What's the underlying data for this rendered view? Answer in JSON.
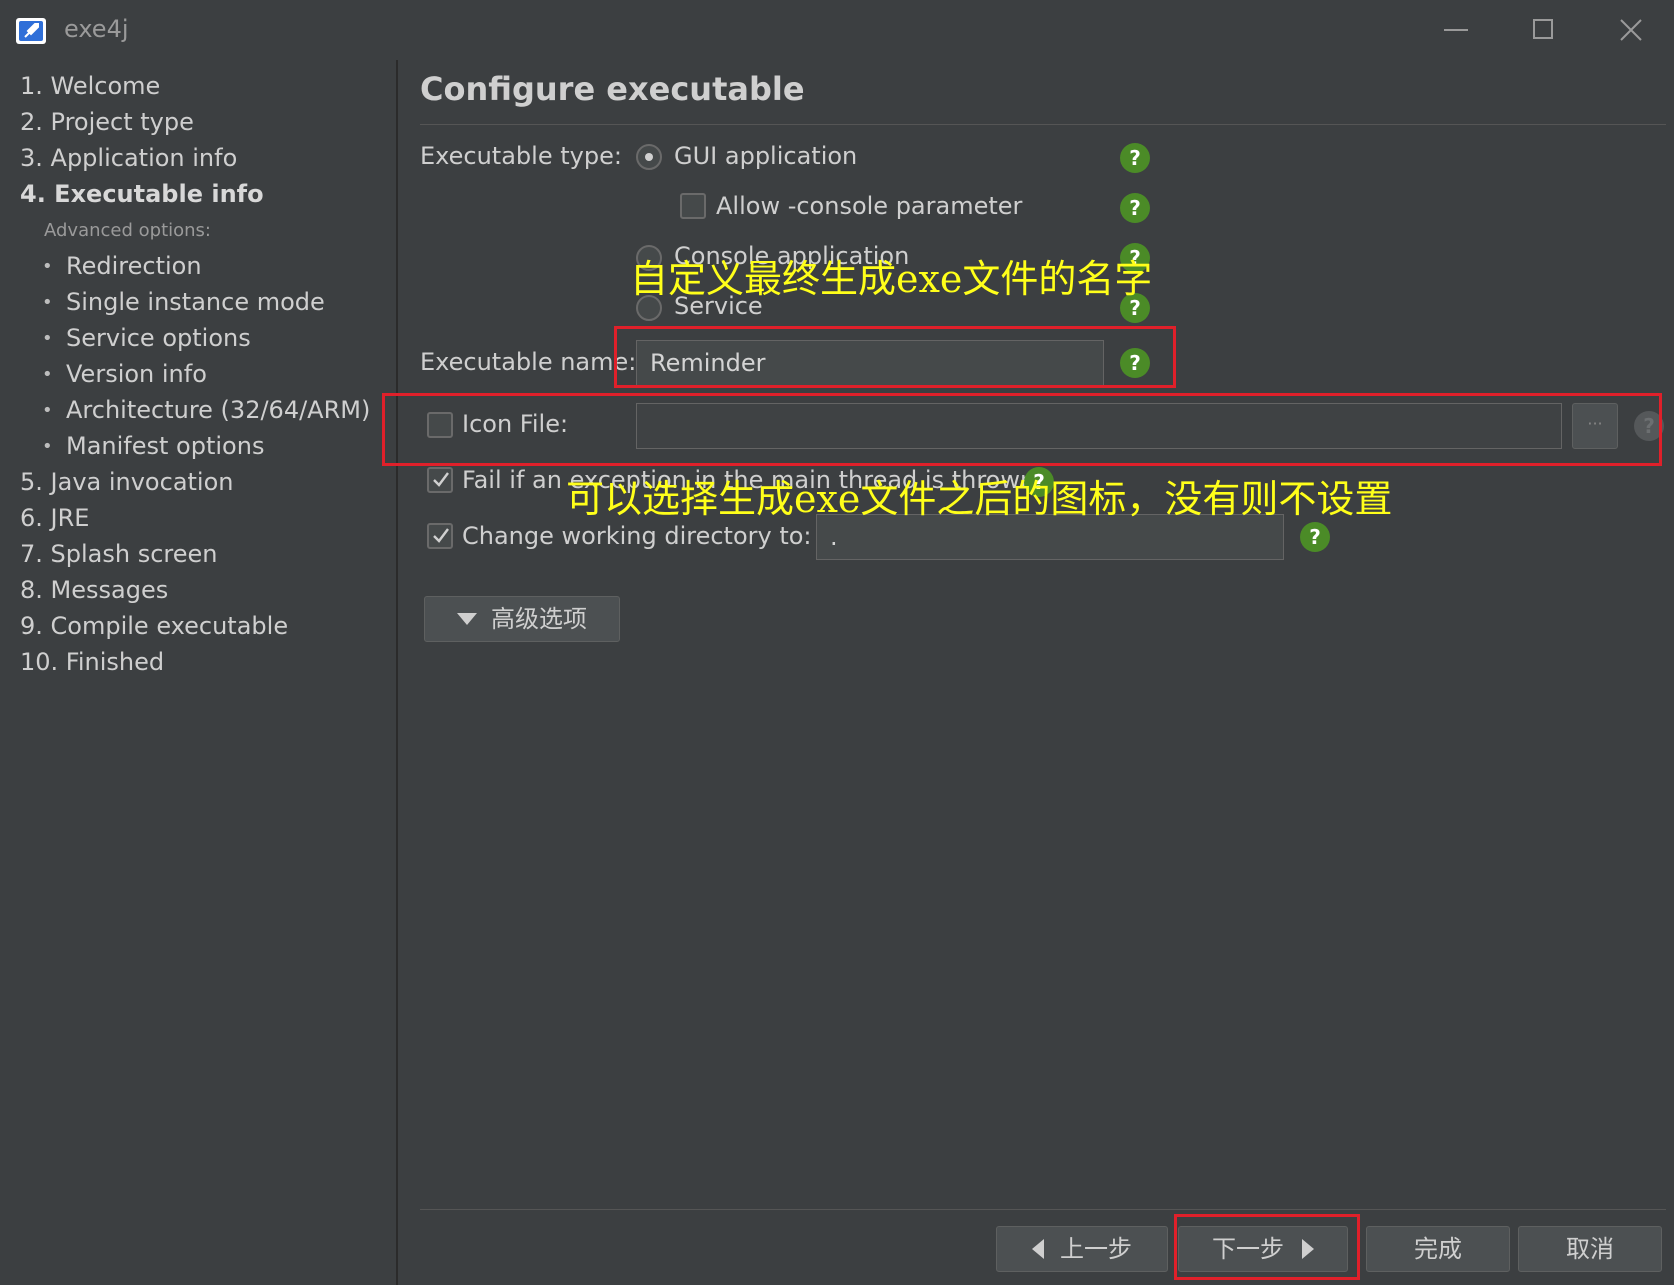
{
  "window": {
    "title": "exe4j",
    "icon": "rocket-icon",
    "controls": [
      "minimize-icon",
      "maximize-icon",
      "close-icon"
    ]
  },
  "sidebar": {
    "steps_top": [
      {
        "label": "1. Welcome"
      },
      {
        "label": "2. Project type"
      },
      {
        "label": "3. Application info"
      },
      {
        "label": "4. Executable info",
        "current": true
      }
    ],
    "advanced_label": "Advanced options:",
    "advanced_items": [
      {
        "label": "Redirection"
      },
      {
        "label": "Single instance mode"
      },
      {
        "label": "Service options"
      },
      {
        "label": "Version info"
      },
      {
        "label": "Architecture (32/64/ARM)"
      },
      {
        "label": "Manifest options"
      }
    ],
    "steps_bottom": [
      {
        "label": "5. Java invocation"
      },
      {
        "label": "6. JRE"
      },
      {
        "label": "7. Splash screen"
      },
      {
        "label": "8. Messages"
      },
      {
        "label": "9. Compile executable"
      },
      {
        "label": "10. Finished"
      }
    ]
  },
  "main": {
    "heading": "Configure executable",
    "executable_type": {
      "label": "Executable type:",
      "gui": {
        "label": "GUI application",
        "checked": true
      },
      "allow_console": {
        "label": "Allow -console parameter",
        "checked": false
      },
      "console": {
        "label": "Console application",
        "checked": false
      },
      "service": {
        "label": "Service",
        "checked": false
      }
    },
    "executable_name": {
      "label": "Executable name:",
      "value": "Reminder"
    },
    "icon_file": {
      "label": "Icon File:",
      "checked": false,
      "value": "",
      "browse_label": "···"
    },
    "fail_exception": {
      "label": "Fail if an exception in the main thread is thrown",
      "checked": true
    },
    "change_dir": {
      "label": "Change working directory to:",
      "checked": true,
      "value": "."
    },
    "advanced_button": "高级选项",
    "help_icon": "?"
  },
  "annotations": {
    "name_note": "自定义最终生成exe文件的名字",
    "icon_note": "可以选择生成exe文件之后的图标，没有则不设置",
    "color": "#e0202a",
    "text_color": "#ffff1a"
  },
  "footer": {
    "back_label": "上一步",
    "next_label": "下一步",
    "finish_label": "完成",
    "cancel_label": "取消"
  }
}
